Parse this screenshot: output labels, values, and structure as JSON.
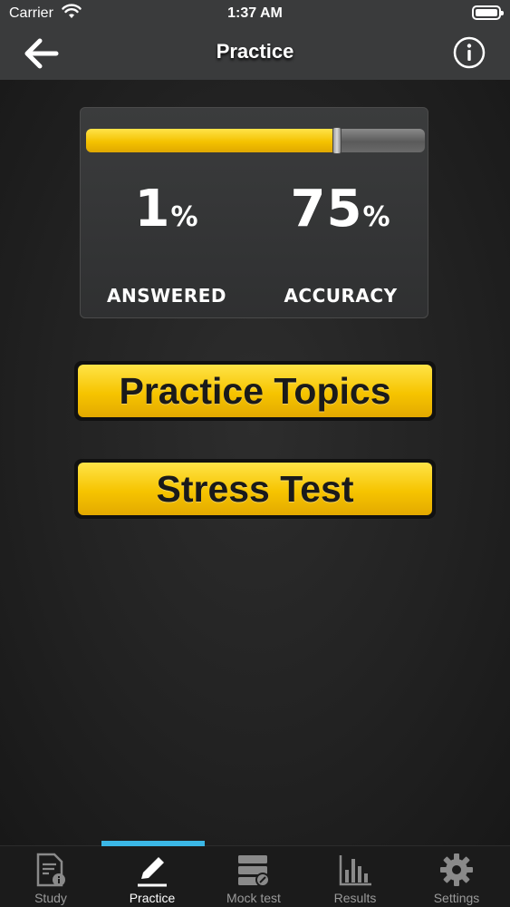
{
  "status_bar": {
    "carrier": "Carrier",
    "time": "1:37 AM"
  },
  "nav": {
    "title": "Practice",
    "back_icon": "back-arrow-icon",
    "info_icon": "info-icon"
  },
  "stats": {
    "progress_fraction": 0.74,
    "answered_value": "1",
    "answered_unit": "%",
    "answered_label": "ANSWERED",
    "accuracy_value": "75",
    "accuracy_unit": "%",
    "accuracy_label": "ACCURACY"
  },
  "buttons": {
    "practice_topics": "Practice Topics",
    "stress_test": "Stress Test"
  },
  "colors": {
    "accent_yellow": "#f6c400",
    "tab_indicator": "#3bb7e6",
    "background": "#1e1e1e"
  },
  "tabs": [
    {
      "label": "Study",
      "icon": "study-icon",
      "active": false
    },
    {
      "label": "Practice",
      "icon": "pencil-icon",
      "active": true
    },
    {
      "label": "Mock test",
      "icon": "mock-test-icon",
      "active": false
    },
    {
      "label": "Results",
      "icon": "bar-chart-icon",
      "active": false
    },
    {
      "label": "Settings",
      "icon": "gear-icon",
      "active": false
    }
  ]
}
